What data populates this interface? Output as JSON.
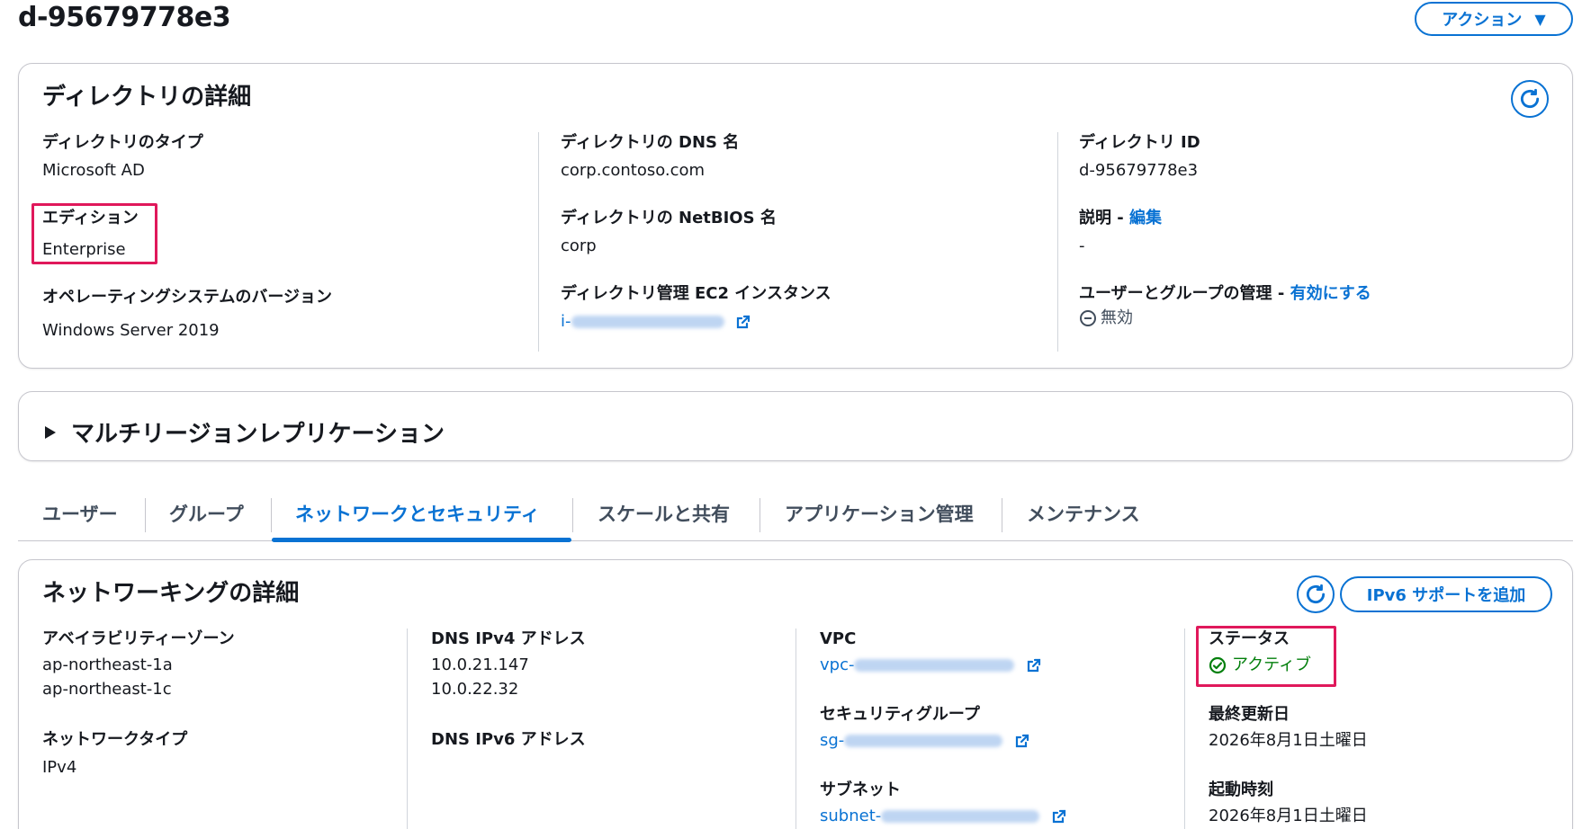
{
  "page": {
    "title": "d-95679778e3",
    "actions_label": "アクション"
  },
  "directory_details": {
    "title": "ディレクトリの詳細",
    "type_label": "ディレクトリのタイプ",
    "type_value": "Microsoft AD",
    "edition_label": "エディション",
    "edition_value": "Enterprise",
    "os_label": "オペレーティングシステムのバージョン",
    "os_value": "Windows Server 2019",
    "dns_name_label": "ディレクトリの DNS 名",
    "dns_name_value": "corp.contoso.com",
    "netbios_label": "ディレクトリの NetBIOS 名",
    "netbios_value": "corp",
    "ec2_label": "ディレクトリ管理 EC2 インスタンス",
    "ec2_value_prefix": "i-",
    "id_label": "ディレクトリ ID",
    "id_value": "d-95679778e3",
    "description_label": "説明 - ",
    "description_edit": "編集",
    "description_value": "-",
    "user_group_label": "ユーザーとグループの管理 - ",
    "user_group_enable": "有効にする",
    "user_group_value": "無効"
  },
  "multi_region": {
    "title": "マルチリージョンレプリケーション"
  },
  "tabs": [
    {
      "label": "ユーザー"
    },
    {
      "label": "グループ"
    },
    {
      "label": "ネットワークとセキュリティ"
    },
    {
      "label": "スケールと共有"
    },
    {
      "label": "アプリケーション管理"
    },
    {
      "label": "メンテナンス"
    }
  ],
  "networking": {
    "title": "ネットワーキングの詳細",
    "ipv6_button": "IPv6 サポートを追加",
    "az_label": "アベイラビリティーゾーン",
    "az_values": [
      "ap-northeast-1a",
      "ap-northeast-1c"
    ],
    "network_type_label": "ネットワークタイプ",
    "network_type_value": "IPv4",
    "dns_ipv4_label": "DNS IPv4 アドレス",
    "dns_ipv4_values": [
      "10.0.21.147",
      "10.0.22.32"
    ],
    "dns_ipv6_label": "DNS IPv6 アドレス",
    "vpc_label": "VPC",
    "vpc_prefix": "vpc-",
    "sg_label": "セキュリティグループ",
    "sg_prefix": "sg-",
    "subnet_label": "サブネット",
    "subnet_prefix": "subnet-",
    "status_label": "ステータス",
    "status_value": "アクティブ",
    "last_updated_label": "最終更新日",
    "last_updated_value": "2026年8月1日土曜日",
    "launch_time_label": "起動時刻",
    "launch_time_value": "2026年8月1日土曜日"
  },
  "colors": {
    "accent": "#0972d3",
    "highlight": "#e0185b",
    "success": "#037f0c"
  }
}
